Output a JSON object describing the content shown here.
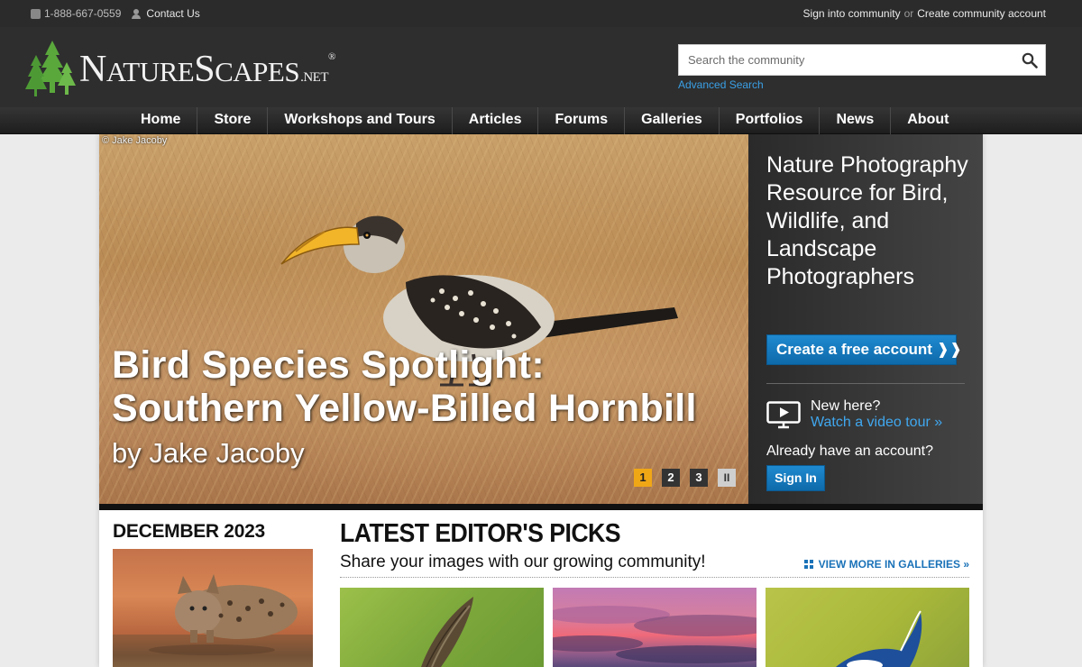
{
  "topbar": {
    "phone": "1-888-667-0559",
    "contact": "Contact Us",
    "sign_in": "Sign into community",
    "or": "or",
    "create": "Create community account"
  },
  "header": {
    "logo_text": "NatureScapes.net",
    "search_placeholder": "Search the community",
    "advanced_search": "Advanced Search"
  },
  "nav": {
    "items": [
      "Home",
      "Store",
      "Workshops and Tours",
      "Articles",
      "Forums",
      "Galleries",
      "Portfolios",
      "News",
      "About"
    ]
  },
  "hero": {
    "credit": "© Jake Jacoby",
    "title_line1": "Bird Species Spotlight:",
    "title_line2": "Southern Yellow-Billed Hornbill",
    "byline": "by Jake Jacoby",
    "pager": [
      "1",
      "2",
      "3",
      "II"
    ],
    "active_slide": 1
  },
  "side": {
    "headline": "Nature Photography Resource for Bird, Wildlife, and Landscape Photographers",
    "cta": "Create a free account ❱❱",
    "new_here": "New here?",
    "video_tour": "Watch a video tour »",
    "already": "Already have an account?",
    "sign_in": "Sign In"
  },
  "monthly": {
    "heading": "DECEMBER 2023"
  },
  "picks": {
    "heading": "LATEST EDITOR'S PICKS",
    "subheading": "Share your images with our growing community!",
    "view_more": "VIEW MORE IN GALLERIES »"
  },
  "colors": {
    "accent_blue": "#1a72b8",
    "link_blue": "#3aa0e6",
    "pager_active": "#f0a716",
    "header_bg": "#2e2e2e"
  }
}
